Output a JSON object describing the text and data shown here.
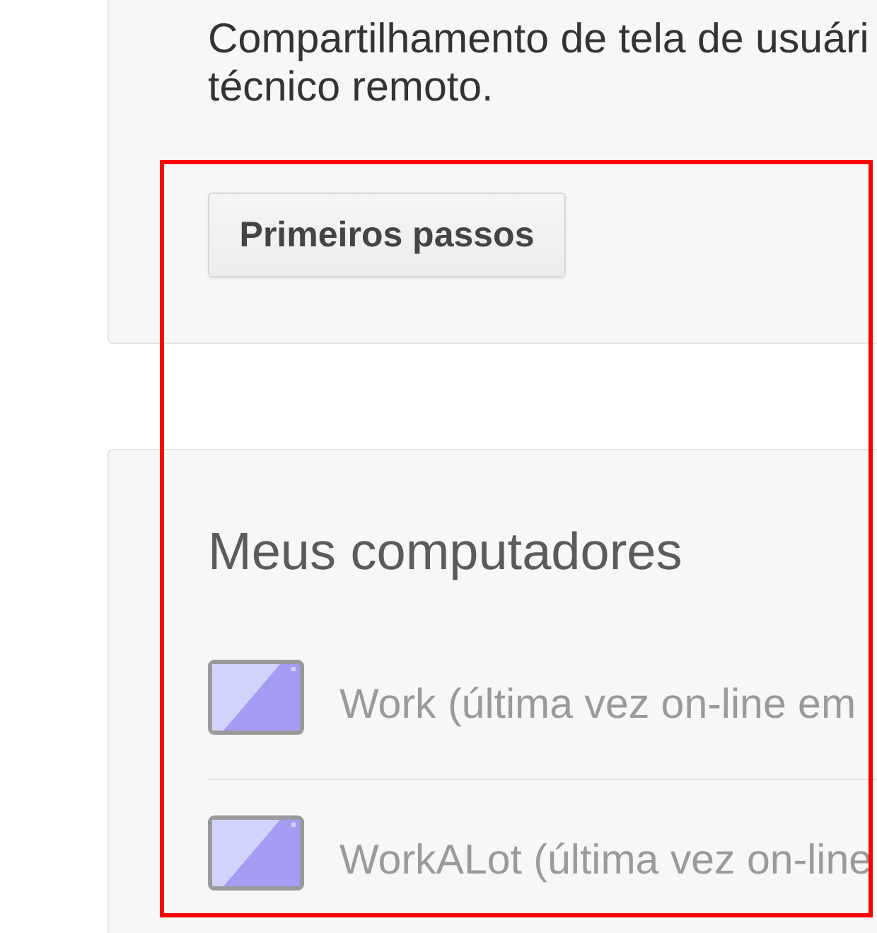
{
  "intro_card": {
    "description_lines": [
      "Compartilhamento de tela de usuári",
      "técnico remoto."
    ],
    "button": {
      "label": "Primeiros passos"
    }
  },
  "computers_card": {
    "title": "Meus computadores",
    "computers": [
      {
        "label": "Work (última vez on-line em"
      },
      {
        "label": "WorkALot (última vez on-line"
      }
    ]
  },
  "annotation": {
    "kind": "rectangle"
  }
}
